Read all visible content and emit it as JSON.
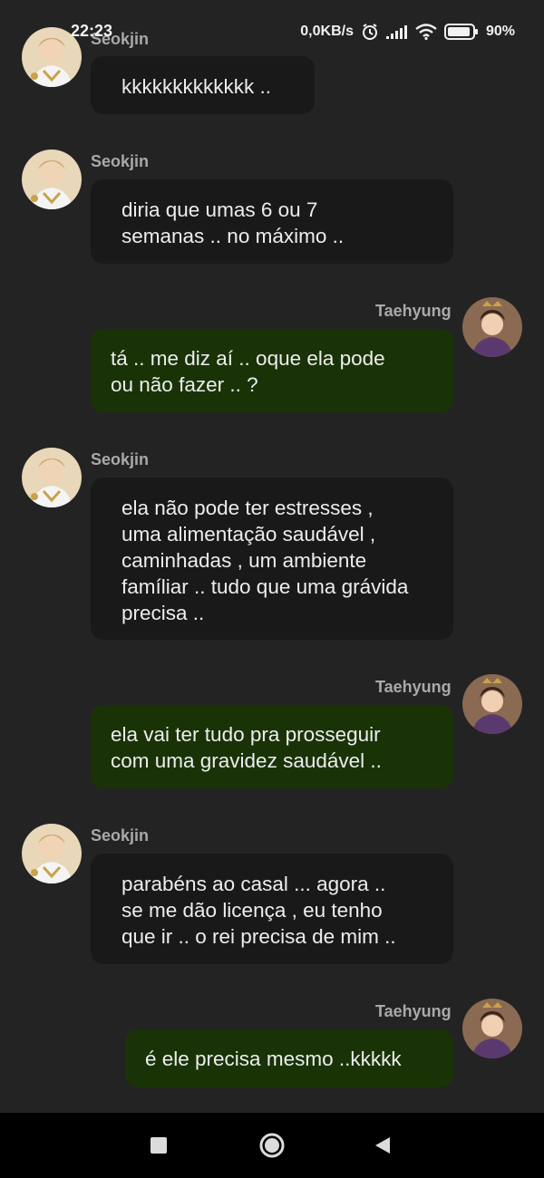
{
  "status_bar": {
    "time": "22:23",
    "net_speed": "0,0KB/s",
    "battery": "90%",
    "icons": [
      "alarm-icon",
      "signal-icon",
      "wifi-icon",
      "battery-icon"
    ]
  },
  "colors": {
    "background": "#232323",
    "incoming_bubble": "#191919",
    "outgoing_bubble": "#193307",
    "text": "#ededed",
    "name": "#a9a9a9"
  },
  "messages": [
    {
      "sender": "Seokjin",
      "text": "kkkkkkkkkkkkk .."
    },
    {
      "sender": "Seokjin",
      "text": "diria que umas 6 ou 7\nsemanas .. no máximo .."
    },
    {
      "sender": "Taehyung",
      "text": "tá .. me diz aí .. oque ela pode\nou não fazer .. ?"
    },
    {
      "sender": "Seokjin",
      "text": "ela não pode ter estresses ,\numa alimentação saudável ,\ncaminhadas , um ambiente\nfamíliar .. tudo que uma grávida\nprecisa .."
    },
    {
      "sender": "Taehyung",
      "text": "ela vai ter tudo pra prosseguir\ncom uma gravidez saudável .."
    },
    {
      "sender": "Seokjin",
      "text": "parabéns ao casal ... agora ..\nse me dão licença , eu tenho\nque ir .. o rei precisa de mim .."
    },
    {
      "sender": "Taehyung",
      "text": "é ele precisa mesmo ..kkkkk"
    }
  ],
  "navigation": {
    "buttons": [
      "recents-square-icon",
      "home-circle-icon",
      "back-triangle-icon"
    ]
  }
}
